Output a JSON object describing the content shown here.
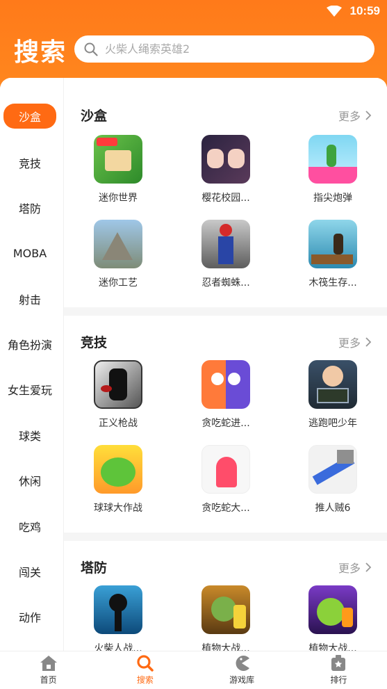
{
  "status": {
    "time": "10:59"
  },
  "header": {
    "title": "搜索",
    "search_placeholder": "火柴人绳索英雄2"
  },
  "sidebar": {
    "items": [
      {
        "label": "沙盒",
        "active": true
      },
      {
        "label": "竞技"
      },
      {
        "label": "塔防"
      },
      {
        "label": "MOBA"
      },
      {
        "label": "射击"
      },
      {
        "label": "角色扮演"
      },
      {
        "label": "女生爱玩"
      },
      {
        "label": "球类"
      },
      {
        "label": "休闲"
      },
      {
        "label": "吃鸡"
      },
      {
        "label": "闯关"
      },
      {
        "label": "动作"
      }
    ]
  },
  "sections": [
    {
      "title": "沙盒",
      "more": "更多",
      "games": [
        {
          "name": "迷你世界"
        },
        {
          "name": "樱花校园..."
        },
        {
          "name": "指尖炮弹"
        },
        {
          "name": "迷你工艺"
        },
        {
          "name": "忍者蜘蛛..."
        },
        {
          "name": "木筏生存..."
        }
      ]
    },
    {
      "title": "竞技",
      "more": "更多",
      "games": [
        {
          "name": "正义枪战"
        },
        {
          "name": "贪吃蛇进..."
        },
        {
          "name": "逃跑吧少年"
        },
        {
          "name": "球球大作战"
        },
        {
          "name": "贪吃蛇大..."
        },
        {
          "name": "推人贼6"
        }
      ]
    },
    {
      "title": "塔防",
      "more": "更多",
      "games": [
        {
          "name": "火柴人战..."
        },
        {
          "name": "植物大战..."
        },
        {
          "name": "植物大战..."
        }
      ]
    }
  ],
  "bottom_nav": [
    {
      "label": "首页",
      "icon": "home-icon"
    },
    {
      "label": "搜索",
      "icon": "search-icon",
      "active": true
    },
    {
      "label": "游戏库",
      "icon": "pacman-icon"
    },
    {
      "label": "排行",
      "icon": "rank-icon"
    }
  ],
  "colors": {
    "accent": "#ff6a13",
    "header": "#ff7a1a"
  }
}
